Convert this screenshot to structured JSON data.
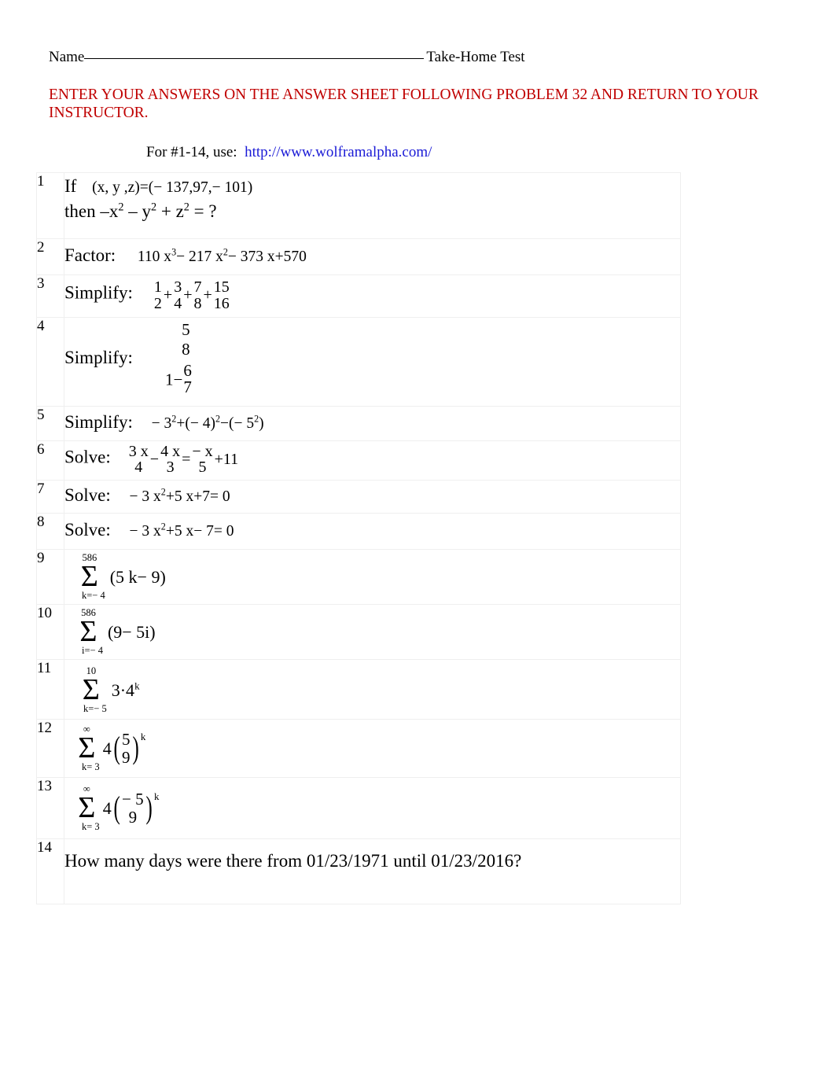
{
  "header": {
    "name_label": "Name",
    "right_label": "Take-Home Test"
  },
  "notice": {
    "text": "ENTER YOUR ANSWERS ON THE ANSWER SHEET FOLLOWING PROBLEM 32 AND RETURN TO YOUR INSTRUCTOR.",
    "color": "#C00000"
  },
  "instruction": {
    "prefix": "For #1-14, use:",
    "url": "http://www.wolframalpha.com/",
    "url_color": "#1A1AD6"
  },
  "problems": [
    {
      "number": "1",
      "label": "If",
      "line1_expr": "(x, y ,z)=(− 137,97,− 101)",
      "line2_prefix": "then –x",
      "line2_sup1": "2",
      "line2_mid1": " – y",
      "line2_sup2": "2",
      "line2_mid2": " + z",
      "line2_sup3": "2",
      "line2_tail": " = ?"
    },
    {
      "number": "2",
      "label": "Factor:",
      "expr_a": "110 x",
      "sup_a": "3",
      "expr_b": "− 217 x",
      "sup_b": "2",
      "expr_c": "− 373 x+570"
    },
    {
      "number": "3",
      "label": "Simplify:",
      "fractions": [
        {
          "n": "1",
          "d": "2"
        },
        {
          "n": "3",
          "d": "4"
        },
        {
          "n": "7",
          "d": "8"
        },
        {
          "n": "15",
          "d": "16"
        }
      ],
      "operators": [
        "+",
        "+",
        "+"
      ]
    },
    {
      "number": "4",
      "label": "Simplify:",
      "top_n": "5",
      "top_d": "8",
      "bot_lead": "1−",
      "bot_n": "6",
      "bot_d": "7"
    },
    {
      "number": "5",
      "label": "Simplify:",
      "part1": "− 3",
      "sup1": "2",
      "part2": "+(− 4)",
      "sup2": "2",
      "part3": "−(−  5",
      "sup3": "2",
      "part4": ")"
    },
    {
      "number": "6",
      "label": "Solve:",
      "f1_n": "3 x",
      "f1_d": "4",
      "op1": "−",
      "f2_n": "4 x",
      "f2_d": "3",
      "op2": "=",
      "f3_n": "− x",
      "f3_d": "5",
      "tail": "+11"
    },
    {
      "number": "7",
      "label": "Solve:",
      "part1": "− 3 x",
      "sup1": "2",
      "part2": "+5 x+7= 0"
    },
    {
      "number": "8",
      "label": "Solve:",
      "part1": "− 3 x",
      "sup1": "2",
      "part2": "+5 x− 7= 0"
    },
    {
      "number": "9",
      "sum_upper": "586",
      "sum_lower": "k=− 4",
      "sum_body": "(5 k− 9)"
    },
    {
      "number": "10",
      "sum_upper": "586",
      "sum_lower": "i=− 4",
      "sum_body": "(9− 5i)"
    },
    {
      "number": "11",
      "sum_upper": "10",
      "sum_lower": "k=− 5",
      "sum_body_pre": "3·4",
      "sum_body_exp": "k"
    },
    {
      "number": "12",
      "sum_upper": "∞",
      "sum_lower": "k= 3",
      "coef": "4",
      "ratio_n": "5",
      "ratio_d": "9",
      "exp": "k"
    },
    {
      "number": "13",
      "sum_upper": "∞",
      "sum_lower": "k= 3",
      "coef": "4",
      "ratio_n": "− 5",
      "ratio_d": "9",
      "exp": "k"
    },
    {
      "number": "14",
      "text": "How many days were there from 01/23/1971 until 01/23/2016?"
    }
  ]
}
